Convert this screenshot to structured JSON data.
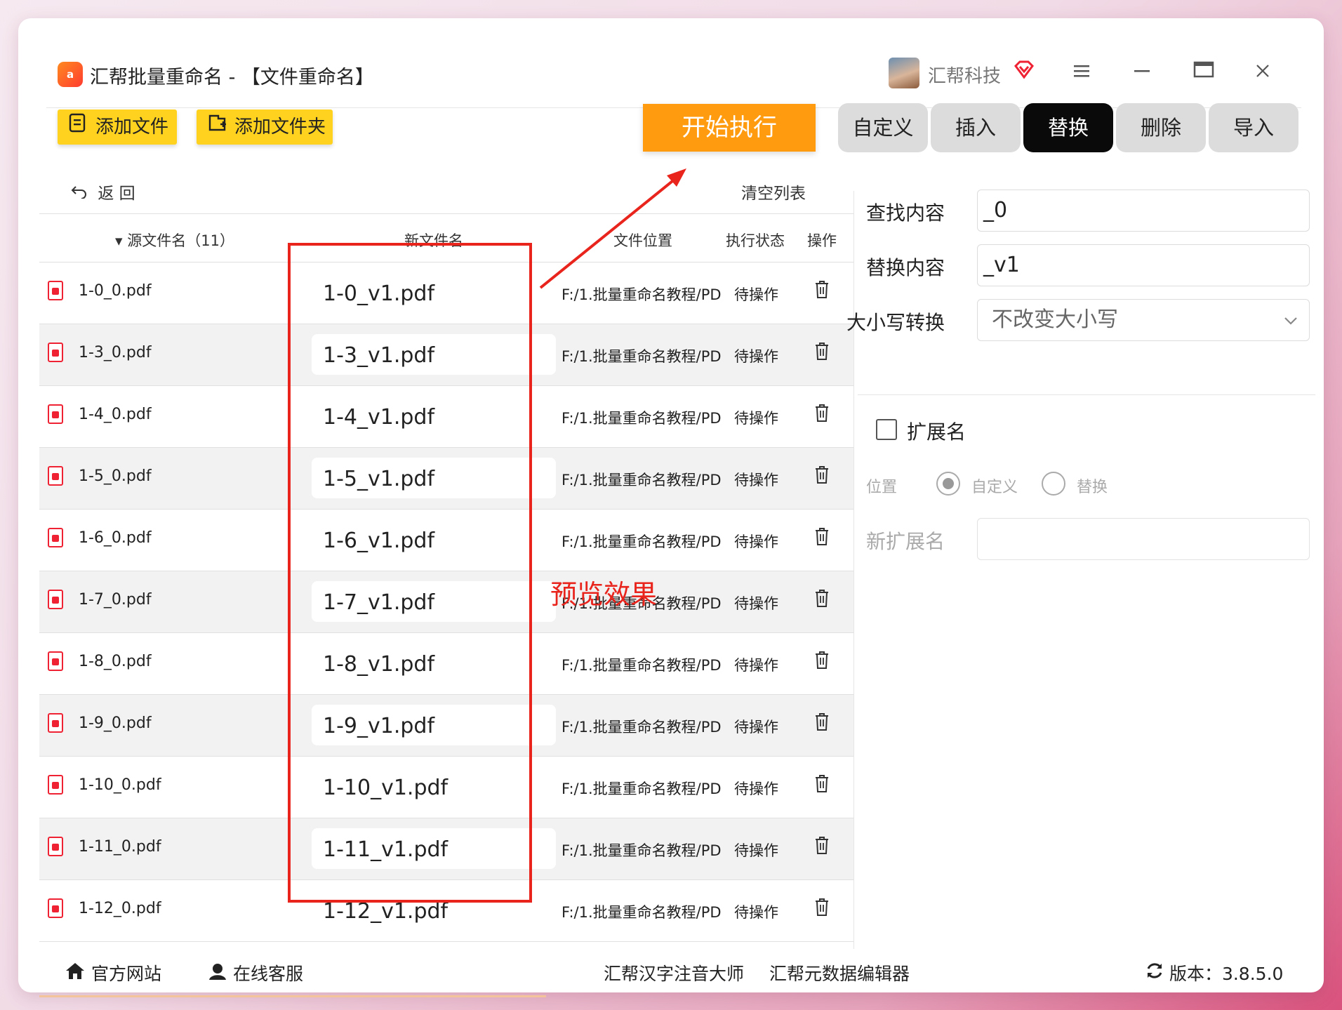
{
  "window": {
    "app_logo": "a",
    "title": "汇帮批量重命名 - 【文件重命名】",
    "company": "汇帮科技",
    "icons": [
      "vip-icon",
      "menu-icon",
      "minimize-icon",
      "maximize-icon",
      "close-icon"
    ]
  },
  "toolbar": {
    "add_file": "添加文件",
    "add_folder": "添加文件夹",
    "start": "开始执行",
    "tabs": [
      "自定义",
      "插入",
      "替换",
      "删除",
      "导入"
    ],
    "active_tab": "替换"
  },
  "list": {
    "back": "返  回",
    "clear": "清空列表",
    "headers": {
      "source": "源文件名（11）",
      "new_name": "新文件名",
      "location": "文件位置",
      "status": "执行状态",
      "action": "操作"
    },
    "rows": [
      {
        "source": "1-0_0.pdf",
        "new_name": "1-0_v1.pdf",
        "location": "F:/1.批量重命名教程/PD",
        "status": "待操作"
      },
      {
        "source": "1-3_0.pdf",
        "new_name": "1-3_v1.pdf",
        "location": "F:/1.批量重命名教程/PD",
        "status": "待操作"
      },
      {
        "source": "1-4_0.pdf",
        "new_name": "1-4_v1.pdf",
        "location": "F:/1.批量重命名教程/PD",
        "status": "待操作"
      },
      {
        "source": "1-5_0.pdf",
        "new_name": "1-5_v1.pdf",
        "location": "F:/1.批量重命名教程/PD",
        "status": "待操作"
      },
      {
        "source": "1-6_0.pdf",
        "new_name": "1-6_v1.pdf",
        "location": "F:/1.批量重命名教程/PD",
        "status": "待操作"
      },
      {
        "source": "1-7_0.pdf",
        "new_name": "1-7_v1.pdf",
        "location": "F:/1.批量重命名教程/PD",
        "status": "待操作"
      },
      {
        "source": "1-8_0.pdf",
        "new_name": "1-8_v1.pdf",
        "location": "F:/1.批量重命名教程/PD",
        "status": "待操作"
      },
      {
        "source": "1-9_0.pdf",
        "new_name": "1-9_v1.pdf",
        "location": "F:/1.批量重命名教程/PD",
        "status": "待操作"
      },
      {
        "source": "1-10_0.pdf",
        "new_name": "1-10_v1.pdf",
        "location": "F:/1.批量重命名教程/PD",
        "status": "待操作"
      },
      {
        "source": "1-11_0.pdf",
        "new_name": "1-11_v1.pdf",
        "location": "F:/1.批量重命名教程/PD",
        "status": "待操作"
      },
      {
        "source": "1-12_0.pdf",
        "new_name": "1-12_v1.pdf",
        "location": "F:/1.批量重命名教程/PD",
        "status": "待操作"
      }
    ]
  },
  "annotation": {
    "preview_label": "预览效果",
    "color": "#e8241c"
  },
  "panel": {
    "find_label": "查找内容",
    "find_value": "_0",
    "replace_label": "替换内容",
    "replace_value": "_v1",
    "case_label": "大小写转换",
    "case_value": "不改变大小写",
    "ext_label": "扩展名",
    "ext_checked": false,
    "position_label": "位置",
    "position_options": [
      "自定义",
      "替换"
    ],
    "position_selected": "自定义",
    "new_ext_label": "新扩展名",
    "new_ext_value": ""
  },
  "footer": {
    "website": "官方网站",
    "support": "在线客服",
    "link1": "汇帮汉字注音大师",
    "link2": "汇帮元数据编辑器",
    "version": "版本：3.8.5.0"
  },
  "colors": {
    "accent_yellow": "#ffd21f",
    "accent_orange": "#ff9b0f",
    "active_tab": "#0a0a0a"
  }
}
